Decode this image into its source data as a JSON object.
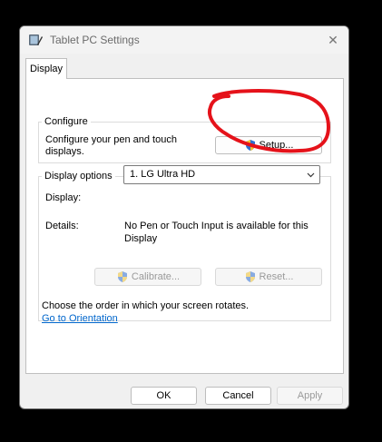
{
  "window": {
    "title": "Tablet PC Settings",
    "close_glyph": "✕"
  },
  "tabs": [
    {
      "label": "Display",
      "active": true
    }
  ],
  "configure": {
    "legend": "Configure",
    "description_line1": "Configure your pen and touch",
    "description_line2": "displays.",
    "setup_label": "Setup..."
  },
  "display_options": {
    "legend": "Display options",
    "display_label": "Display:",
    "display_value": "1. LG Ultra HD",
    "details_label": "Details:",
    "details_line1": "No Pen or Touch Input is available for this",
    "details_line2": "Display",
    "calibrate_label": "Calibrate...",
    "reset_label": "Reset..."
  },
  "orientation": {
    "text": "Choose the order in which your screen rotates.",
    "link": "Go to Orientation"
  },
  "footer": {
    "ok_label": "OK",
    "cancel_label": "Cancel",
    "apply_label": "Apply"
  },
  "icons": {
    "app": "tablet-pc-icon",
    "uac_shield": "uac-shield-icon",
    "dropdown": "chevron-down-icon"
  },
  "colors": {
    "annotation_circle": "#e5121a",
    "link": "#0066cc",
    "disabled_text": "#9a9a9a"
  }
}
